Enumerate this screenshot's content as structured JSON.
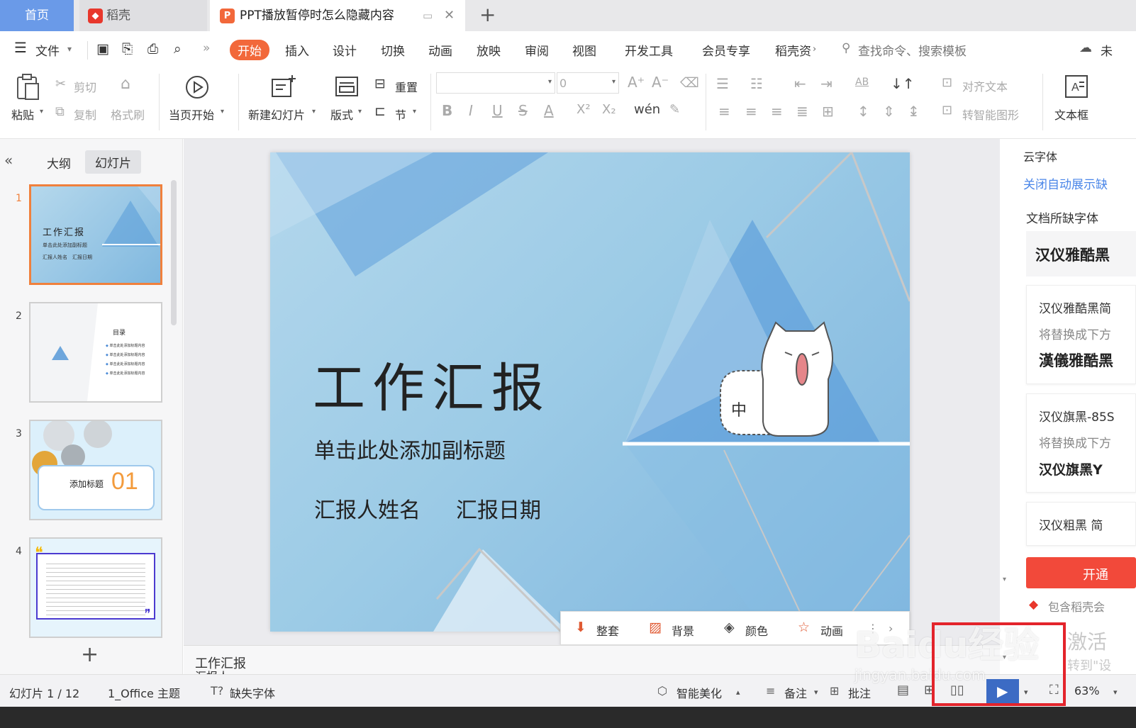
{
  "tabs": {
    "home": "首页",
    "daoke": "稻壳",
    "doc": "PPT播放暂停时怎么隐藏内容",
    "new_tab": "+"
  },
  "menu": {
    "file": "文件",
    "items": [
      "开始",
      "插入",
      "设计",
      "切换",
      "动画",
      "放映",
      "审阅",
      "视图",
      "开发工具",
      "会员专享",
      "稻壳资"
    ],
    "search": "查找命令、搜索模板",
    "cloud": "未"
  },
  "ribbon": {
    "paste": "粘贴",
    "cut": "剪切",
    "copy": "复制",
    "format_painter": "格式刷",
    "from_current": "当页开始",
    "new_slide": "新建幻灯片",
    "layout": "版式",
    "reset": "重置",
    "section": "节",
    "font_size": "0",
    "align_text": "对齐文本",
    "smartart": "转智能图形",
    "textbox": "文本框"
  },
  "leftpanel": {
    "outline": "大纲",
    "slides": "幻灯片",
    "slide_numbers": [
      "1",
      "2",
      "3",
      "4"
    ],
    "thumb1": {
      "title": "工作汇报",
      "sub": "单击此处添加副标题",
      "meta": "汇报人姓名　汇报日期"
    },
    "thumb2": {
      "title": "目录",
      "items": [
        "单击此处添加标题内容",
        "单击此处添加标题内容",
        "单击此处添加标题内容",
        "单击此处添加标题内容"
      ]
    },
    "thumb3": {
      "title": "添加标题",
      "num": "01"
    },
    "add": "+"
  },
  "slide": {
    "title": "工作汇报",
    "subtitle": "单击此处添加副标题",
    "reporter": "汇报人姓名",
    "date": "汇报日期",
    "bubble": "中"
  },
  "floatbar": {
    "whole": "整套",
    "background": "背景",
    "color": "颜色",
    "animation": "动画"
  },
  "notes": {
    "line1": "工作汇报",
    "line2": "汇报人"
  },
  "rightpanel": {
    "font_source": "云字体",
    "close_auto": "关闭自动展示缺",
    "missing_title": "文档所缺字体",
    "font1": "汉仪雅酷黑",
    "card1": {
      "name": "汉仪雅酷黑简",
      "hint": "将替换成下方",
      "preview": "漢儀雅酷黑"
    },
    "card2": {
      "name": "汉仪旗黑-85S",
      "hint": "将替换成下方",
      "preview": "汉仪旗黑Y"
    },
    "card3": {
      "name": "汉仪粗黑 简"
    },
    "open_btn": "开通",
    "member_note": "包含稻壳会",
    "activate": "激活",
    "goto": "转到\"设"
  },
  "statusbar": {
    "slide_count": "幻灯片 1 / 12",
    "theme": "1_Office 主题",
    "missing_font": "缺失字体",
    "beautify": "智能美化",
    "notes": "备注",
    "comment": "批注",
    "zoom": "63%"
  },
  "watermark": {
    "brand": "Baidu经验",
    "url": "jingyan.baidu.com"
  },
  "colors": {
    "accent": "#f2683a",
    "home_tab": "#6a9ae8",
    "highlight_box": "#e3242b"
  }
}
